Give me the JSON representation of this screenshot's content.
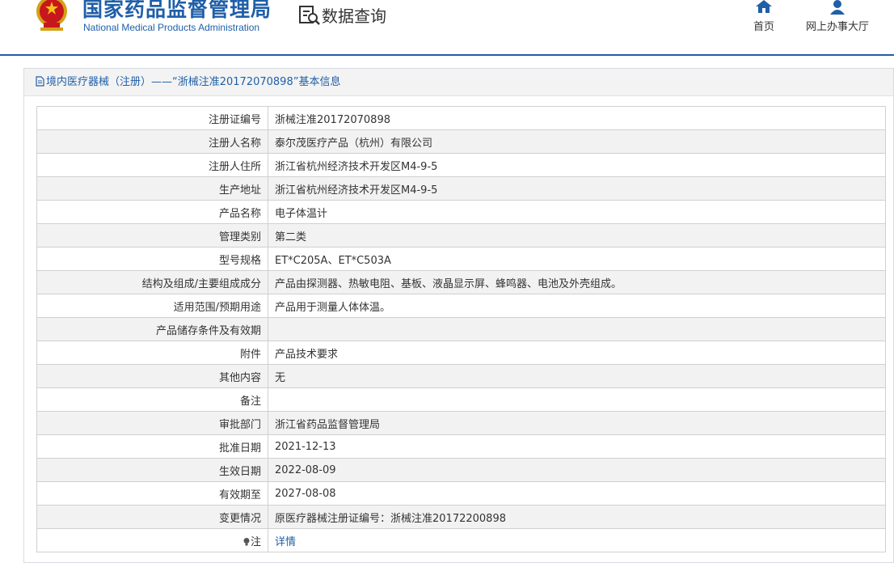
{
  "header": {
    "agency_cn": "国家药品监督管理局",
    "agency_en": "National Medical Products Administration",
    "query_title": "数据查询",
    "nav": [
      {
        "label": "首页",
        "icon": "home-icon"
      },
      {
        "label": "网上办事大厅",
        "icon": "user-icon"
      }
    ]
  },
  "panel": {
    "title": "境内医疗器械（注册）——“浙械注准20172070898”基本信息",
    "rows": [
      {
        "label": "注册证编号",
        "value": "浙械注准20172070898"
      },
      {
        "label": "注册人名称",
        "value": "泰尔茂医疗产品（杭州）有限公司"
      },
      {
        "label": "注册人住所",
        "value": "浙江省杭州经济技术开发区M4-9-5"
      },
      {
        "label": "生产地址",
        "value": "浙江省杭州经济技术开发区M4-9-5"
      },
      {
        "label": "产品名称",
        "value": "电子体温计"
      },
      {
        "label": "管理类别",
        "value": "第二类"
      },
      {
        "label": "型号规格",
        "value": "ET*C205A、ET*C503A"
      },
      {
        "label": "结构及组成/主要组成成分",
        "value": "产品由探测器、热敏电阻、基板、液晶显示屏、蜂鸣器、电池及外壳组成。"
      },
      {
        "label": "适用范围/预期用途",
        "value": "产品用于测量人体体温。"
      },
      {
        "label": "产品储存条件及有效期",
        "value": ""
      },
      {
        "label": "附件",
        "value": "产品技术要求"
      },
      {
        "label": "其他内容",
        "value": "无"
      },
      {
        "label": "备注",
        "value": ""
      },
      {
        "label": "审批部门",
        "value": "浙江省药品监督管理局"
      },
      {
        "label": "批准日期",
        "value": "2021-12-13"
      },
      {
        "label": "生效日期",
        "value": "2022-08-09"
      },
      {
        "label": "有效期至",
        "value": "2027-08-08"
      },
      {
        "label": "变更情况",
        "value": "原医疗器械注册证编号：浙械注准20172200898"
      }
    ],
    "note_row": {
      "label": "注",
      "link": "详情",
      "icon": "lightbulb-icon"
    }
  },
  "colors": {
    "brand_blue": "#1f5fa8",
    "row_alt": "#f2f2f2",
    "border": "#d0d0d0"
  }
}
